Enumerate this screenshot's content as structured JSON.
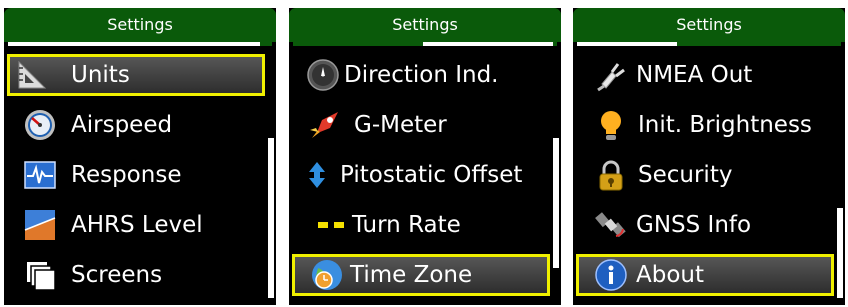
{
  "panels": [
    {
      "title": "Settings",
      "items": [
        {
          "label": "Units",
          "icon": "set-square-icon",
          "selected": true
        },
        {
          "label": "Airspeed",
          "icon": "airspeed-gauge-icon",
          "selected": false
        },
        {
          "label": "Response",
          "icon": "response-graph-icon",
          "selected": false
        },
        {
          "label": "AHRS Level",
          "icon": "ahrs-horizon-icon",
          "selected": false
        },
        {
          "label": "Screens",
          "icon": "screens-icon",
          "selected": false
        }
      ]
    },
    {
      "title": "Settings",
      "items": [
        {
          "label": "Direction Ind.",
          "icon": "compass-icon",
          "selected": false
        },
        {
          "label": "G-Meter",
          "icon": "rocket-icon",
          "selected": false
        },
        {
          "label": "Pitostatic Offset",
          "icon": "up-down-arrow-icon",
          "selected": false
        },
        {
          "label": "Turn Rate",
          "icon": "turn-rate-icon",
          "selected": false
        },
        {
          "label": "Time Zone",
          "icon": "globe-clock-icon",
          "selected": true
        }
      ]
    },
    {
      "title": "Settings",
      "items": [
        {
          "label": "NMEA Out",
          "icon": "plug-icon",
          "selected": false
        },
        {
          "label": "Init. Brightness",
          "icon": "light-bulb-icon",
          "selected": false
        },
        {
          "label": "Security",
          "icon": "padlock-icon",
          "selected": false
        },
        {
          "label": "GNSS Info",
          "icon": "satellite-icon",
          "selected": false
        },
        {
          "label": "About",
          "icon": "info-icon",
          "selected": true
        }
      ]
    }
  ],
  "colors": {
    "header": "#0a5a0a",
    "selection_outline": "#f0f000",
    "background": "#000000",
    "text": "#ffffff"
  }
}
